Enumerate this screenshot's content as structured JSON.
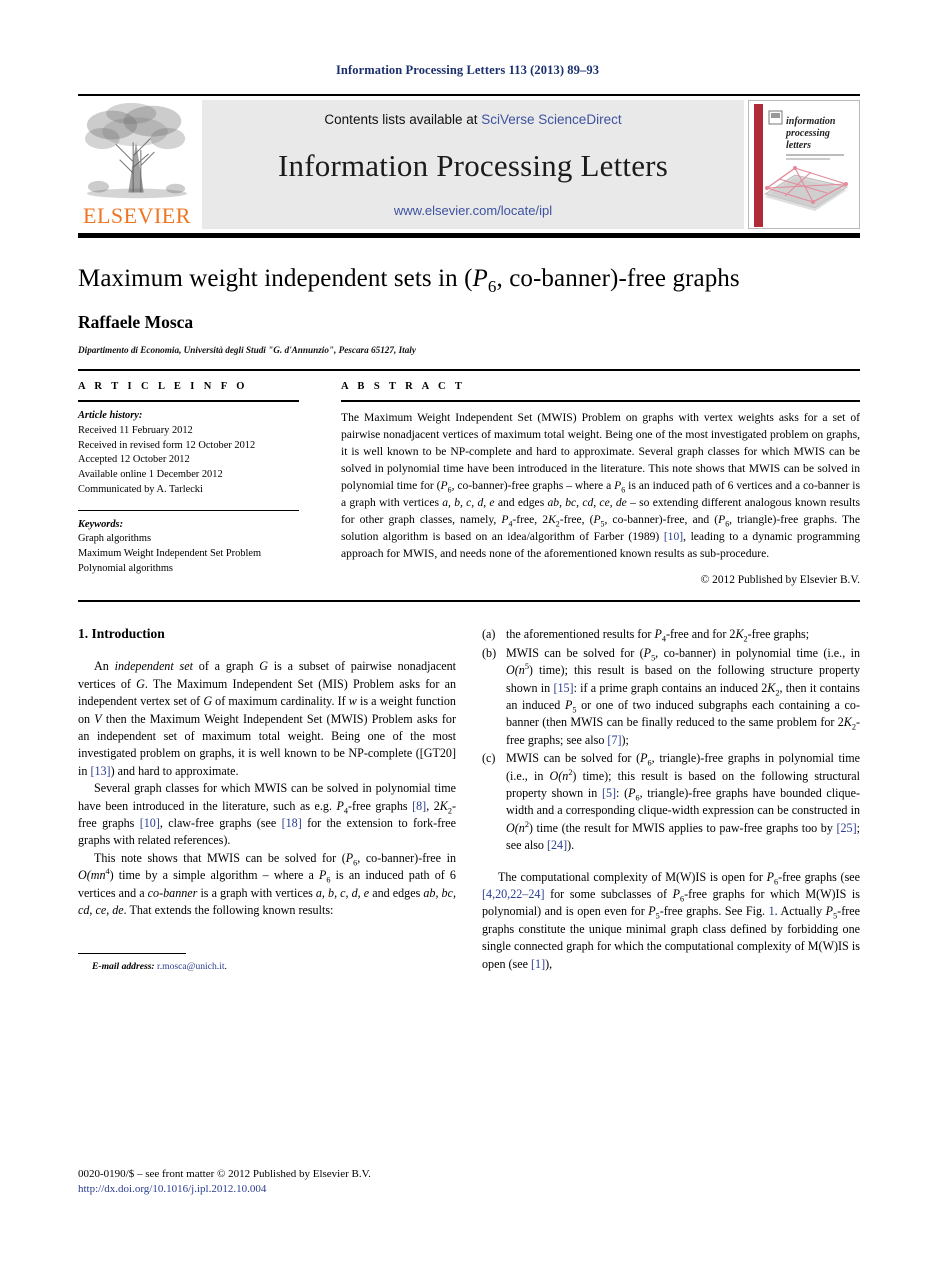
{
  "header": {
    "running_head": "Information Processing Letters 113 (2013) 89–93",
    "contents_prefix": "Contents lists available at ",
    "contents_link": "SciVerse ScienceDirect",
    "journal_title": "Information Processing Letters",
    "journal_url": "www.elsevier.com/locate/ipl",
    "publisher_name": "ELSEVIER",
    "cover_title_line1": "information",
    "cover_title_line2": "processing",
    "cover_title_line3": "letters"
  },
  "colors": {
    "link": "#3e52a0",
    "reference": "#2a3d8f",
    "runhead": "#1a2f6e",
    "elsevier_orange": "#ee7623",
    "banner_gray": "#e9e9e9",
    "cover_red": "#b02a37"
  },
  "article": {
    "title_part1": "Maximum weight independent sets in (",
    "title_p6_base": "P",
    "title_p6_sub": "6",
    "title_part2": ", co-banner)-free graphs",
    "author": "Raffaele Mosca",
    "affiliation": "Dipartimento di Economia, Università degli Studi \"G. d'Annunzio\", Pescara 65127, Italy"
  },
  "info": {
    "heading": "A R T I C L E   I N F O",
    "history_label": "Article history:",
    "history": [
      "Received 11 February 2012",
      "Received in revised form 12 October 2012",
      "Accepted 12 October 2012",
      "Available online 1 December 2012",
      "Communicated by A. Tarlecki"
    ],
    "keywords_label": "Keywords:",
    "keywords": [
      "Graph algorithms",
      "Maximum Weight Independent Set Problem",
      "Polynomial algorithms"
    ]
  },
  "abstract": {
    "heading": "A B S T R A C T",
    "text_1": "The Maximum Weight Independent Set (MWIS) Problem on graphs with vertex weights asks for a set of pairwise nonadjacent vertices of maximum total weight. Being one of the most investigated problem on graphs, it is well known to be NP-complete and hard to approximate. Several graph classes for which MWIS can be solved in polynomial time have been introduced in the literature. This note shows that MWIS can be solved in polynomial time for (",
    "text_2": ", co-banner)-free graphs – where a ",
    "text_3": " is an induced path of 6 vertices and a co-banner is a graph with vertices ",
    "vertices": "a, b, c, d, e",
    "text_4": " and edges ",
    "edges": "ab, bc, cd, ce, de",
    "text_5": " – so extending different analogous known results for other graph classes, namely, ",
    "text_6": "-free, 2",
    "text_7": "-free, (",
    "text_8": ", co-banner)-free, and (",
    "text_9": ", triangle)-free graphs. The solution algorithm is based on an idea/algorithm of Farber (1989) ",
    "ref_farber": "[10]",
    "text_10": ", leading to a dynamic programming approach for MWIS, and needs none of the aforementioned known results as sub-procedure.",
    "copyright": "© 2012 Published by Elsevier B.V."
  },
  "body": {
    "section_heading": "1. Introduction",
    "p1_a": "An ",
    "p1_ital": "independent set",
    "p1_b": " of a graph ",
    "p1_G1": "G",
    "p1_c": " is a subset of pairwise nonadjacent vertices of ",
    "p1_G2": "G",
    "p1_d": ". The Maximum Independent Set (MIS) Problem asks for an independent vertex set of ",
    "p1_G3": "G",
    "p1_e": " of maximum cardinality. If ",
    "p1_w": "w",
    "p1_f": " is a weight function on ",
    "p1_V": "V",
    "p1_g": " then the Maximum Weight Independent Set (MWIS) Problem asks for an independent set of maximum total weight. Being one of the most investigated problem on graphs, it is well known to be NP-complete ([GT20] in ",
    "p1_ref": "[13]",
    "p1_h": ") and hard to approximate.",
    "p2_a": "Several graph classes for which MWIS can be solved in polynomial time have been introduced in the literature, such as e.g. ",
    "p2_b": "-free graphs ",
    "p2_ref1": "[8]",
    "p2_c": ", 2",
    "p2_d": "-free graphs ",
    "p2_ref2": "[10]",
    "p2_e": ", claw-free graphs (see ",
    "p2_ref3": "[18]",
    "p2_f": " for the extension to fork-free graphs with related references).",
    "p3_a": "This note shows that MWIS can be solved for (",
    "p3_b": ", co-banner)-free in ",
    "p3_O": "O(mn",
    "p3_Osup": "4",
    "p3_c": ") time by a simple algorithm – where a ",
    "p3_d": " is an induced path of 6 vertices and a ",
    "p3_ital": "co-banner",
    "p3_e": " is a graph with vertices ",
    "p3_vertices": "a, b, c, d, e",
    "p3_f": " and edges ",
    "p3_edges": "ab, bc, cd, ce, de",
    "p3_g": ". That extends the following known results:",
    "items": [
      {
        "mark": "(a)",
        "a": "the aforementioned results for ",
        "b": "-free and for 2",
        "c": "-free graphs;"
      },
      {
        "mark": "(b)",
        "a": "MWIS can be solved for (",
        "p5": "P",
        "p5sub": "5",
        "b": ", co-banner) in polynomial time (i.e., in ",
        "O": "O(n",
        "Osup": "5",
        "c": ") time); this result is based on the following structure property shown in ",
        "ref1": "[15]",
        "d": ": if a prime graph contains an induced 2",
        "e": ", then it contains an induced ",
        "f": " or one of two induced subgraphs each containing a co-banner (then MWIS can be finally reduced to the same problem for 2",
        "g": "-free graphs; see also ",
        "ref2": "[7]",
        "h": ");"
      },
      {
        "mark": "(c)",
        "a": "MWIS can be solved for (",
        "b": ", triangle)-free graphs in polynomial time (i.e., in ",
        "O1": "O(n",
        "O1sup": "2",
        "c": ") time); this result is based on the following structural property shown in ",
        "ref1": "[5]",
        "d": ": (",
        "e": ", triangle)-free graphs have bounded clique-width and a corresponding clique-width expression can be constructed in ",
        "O2": "O(n",
        "O2sup": "2",
        "f": ") time (the result for MWIS applies to paw-free graphs too by ",
        "ref2": "[25]",
        "g": "; see also ",
        "ref3": "[24]",
        "h": ")."
      }
    ],
    "p4_a": "The computational complexity of M(W)IS is open for ",
    "p4_b": "-free graphs (see ",
    "p4_ref1": "[4,20,22–24]",
    "p4_c": " for some subclasses of ",
    "p4_d": "-free graphs for which M(W)IS is polynomial) and is open even for ",
    "p4_e": "-free graphs. See Fig. ",
    "p4_figref": "1",
    "p4_f": ". Actually ",
    "p4_g": "-free graphs constitute the unique minimal graph class defined by forbidding one single connected graph for which the computational complexity of M(W)IS is open (see ",
    "p4_ref2": "[1]",
    "p4_h": "),"
  },
  "footnote": {
    "label": "E-mail address:",
    "email": "r.mosca@unich.it",
    "trailing": "."
  },
  "page_footer": {
    "issn_line": "0020-0190/$ – see front matter  © 2012 Published by Elsevier B.V.",
    "doi": "http://dx.doi.org/10.1016/j.ipl.2012.10.004"
  }
}
